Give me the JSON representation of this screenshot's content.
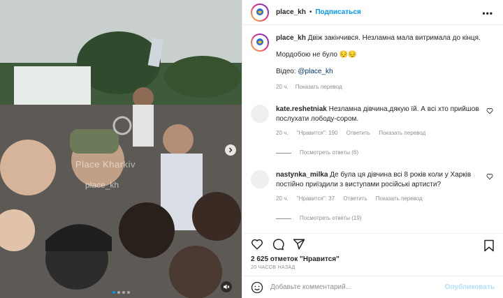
{
  "post": {
    "username": "place_kh",
    "follow_label": "Подписаться",
    "more_label": "•••",
    "watermark_text": "Place Kharkiv",
    "watermark_handle": "place_kh"
  },
  "caption": {
    "username": "place_kh",
    "text1": "Двіж закінчився. Незламна мала витримала до кінця.",
    "text2": "Мордобою не було 😔😔",
    "video_label": "Відео: ",
    "video_tag": "@place_kh",
    "time": "20 ч.",
    "translate": "Показать перевод"
  },
  "comments": [
    {
      "username": "kate.reshetniak",
      "text": "Незламна дівчина,дякую їй. А всі хто прийшов послухати лободу-сором.",
      "time": "20 ч.",
      "likes": "\"Нравится\": 190",
      "reply": "Ответить",
      "translate": "Показать перевод",
      "replies_label": "Посмотреть ответы (6)"
    },
    {
      "username": "nastynka_milka",
      "text": "Де була ця дівчина всі 8 років коли у Харків постійно приїздили з виступами російські артисти?",
      "time": "20 ч.",
      "likes": "\"Нравится\": 37",
      "reply": "Ответить",
      "translate": "Показать перевод",
      "replies_label": "Посмотреть ответы (19)"
    }
  ],
  "footer": {
    "likes_text": "2 625 отметок \"Нравится\"",
    "time_ago": "20 ЧАСОВ НАЗАД",
    "comment_placeholder": "Добавьте комментарий...",
    "post_label": "Опубликовать"
  },
  "icons": [
    "heart-icon",
    "comment-icon",
    "share-icon",
    "bookmark-icon",
    "emoji-icon",
    "more-icon",
    "chevron-right-icon",
    "mute-icon"
  ],
  "colors": {
    "accent": "#0095f6",
    "muted": "#8e8e8e",
    "post_disabled": "#b2dffc"
  }
}
